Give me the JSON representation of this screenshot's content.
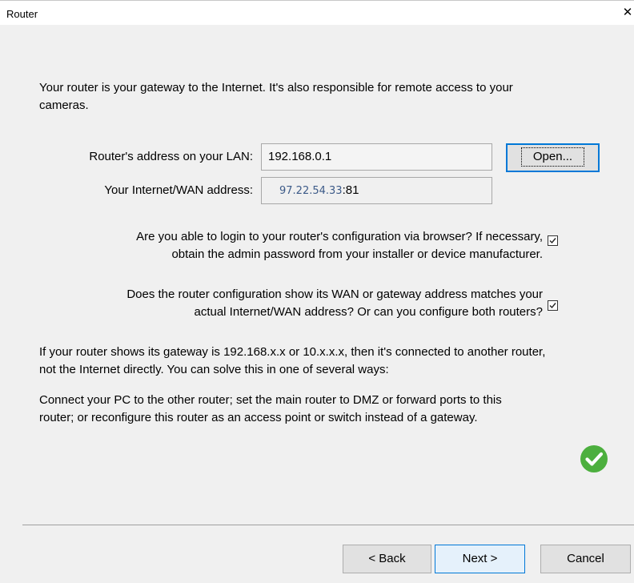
{
  "window": {
    "title": "Router",
    "close_symbol": "✕"
  },
  "intro": {
    "line1": "Your router is your gateway to the Internet.  It's also responsible for remote access to your",
    "line2": "cameras."
  },
  "fields": {
    "lan_label": "Router's address on your LAN:",
    "lan_value": "192.168.0.1",
    "open_button": "Open...",
    "wan_label": "Your Internet/WAN address:",
    "wan_ip": "97.22.54.33",
    "wan_port": ":81"
  },
  "questions": [
    {
      "line1": "Are you able to login to your router's configuration via browser?  If necessary,",
      "line2": "obtain the admin password from your installer or device manufacturer.",
      "checked": true
    },
    {
      "line1": "Does the router configuration show its WAN or gateway address matches your",
      "line2": "actual Internet/WAN address?  Or can you configure both routers?",
      "checked": true
    }
  ],
  "info": {
    "p1_line1": "If your router shows its gateway is 192.168.x.x or 10.x.x.x, then it's connected to another router,",
    "p1_line2": "not the Internet directly.  You can solve this in one of several ways:",
    "p2_line1": "Connect your PC to the other router; set the main router to DMZ or forward ports to this",
    "p2_line2": "router; or reconfigure this router as an access point or switch instead of a gateway."
  },
  "status_icon": "check-circle-icon",
  "status_color": "#4caf3e",
  "buttons": {
    "back": "< Back",
    "next": "Next >",
    "cancel": "Cancel"
  }
}
